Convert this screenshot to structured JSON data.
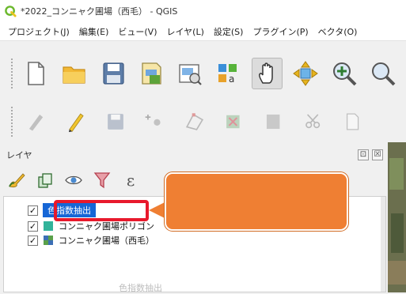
{
  "window": {
    "title": "*2022_コンニャク圃場（西毛） - QGIS",
    "logo": "qgis-logo"
  },
  "menubar": {
    "items": [
      {
        "label": "プロジェクト(J)"
      },
      {
        "label": "編集(E)"
      },
      {
        "label": "ビュー(V)"
      },
      {
        "label": "レイヤ(L)"
      },
      {
        "label": "設定(S)"
      },
      {
        "label": "プラグイン(P)"
      },
      {
        "label": "ベクタ(O)"
      }
    ]
  },
  "toolbar_main": {
    "buttons": [
      "new-project-icon",
      "open-project-icon",
      "save-project-icon",
      "print-layout-icon",
      "layout-manager-icon",
      "style-manager-icon",
      "pan-hand-icon",
      "pan-to-selection-icon",
      "zoom-in-icon",
      "zoom-out-icon"
    ]
  },
  "toolbar_digitize": {
    "buttons": [
      "edits-icon",
      "toggle-editing-icon",
      "save-edits-icon",
      "add-feature-icon",
      "vertex-tool-icon",
      "delete-selected-icon",
      "cut-features-icon",
      "copy-features-icon",
      "paste-features-icon",
      "undo-icon"
    ]
  },
  "layers_panel": {
    "title": "レイヤ",
    "float_btn": "⊡",
    "close_btn": "☒",
    "tools": [
      "style-brush-icon",
      "add-group-icon",
      "visibility-eye-icon",
      "filter-icon",
      "expression-filter-icon"
    ],
    "tool_text": "ε"
  },
  "layers": [
    {
      "name": "色指数抽出",
      "checked": true,
      "selected": true,
      "check_mark": "✓"
    },
    {
      "name": "コンニャク圃場ポリゴン",
      "checked": true,
      "selected": false,
      "check_mark": "✓"
    },
    {
      "name": "コンニャク圃場（西毛）",
      "checked": true,
      "selected": false,
      "check_mark": "✓"
    }
  ],
  "faded_text": "色指数抽出",
  "colors": {
    "callout": "#ef7f33",
    "highlight_box": "#e8192c",
    "selection": "#1666d6"
  }
}
